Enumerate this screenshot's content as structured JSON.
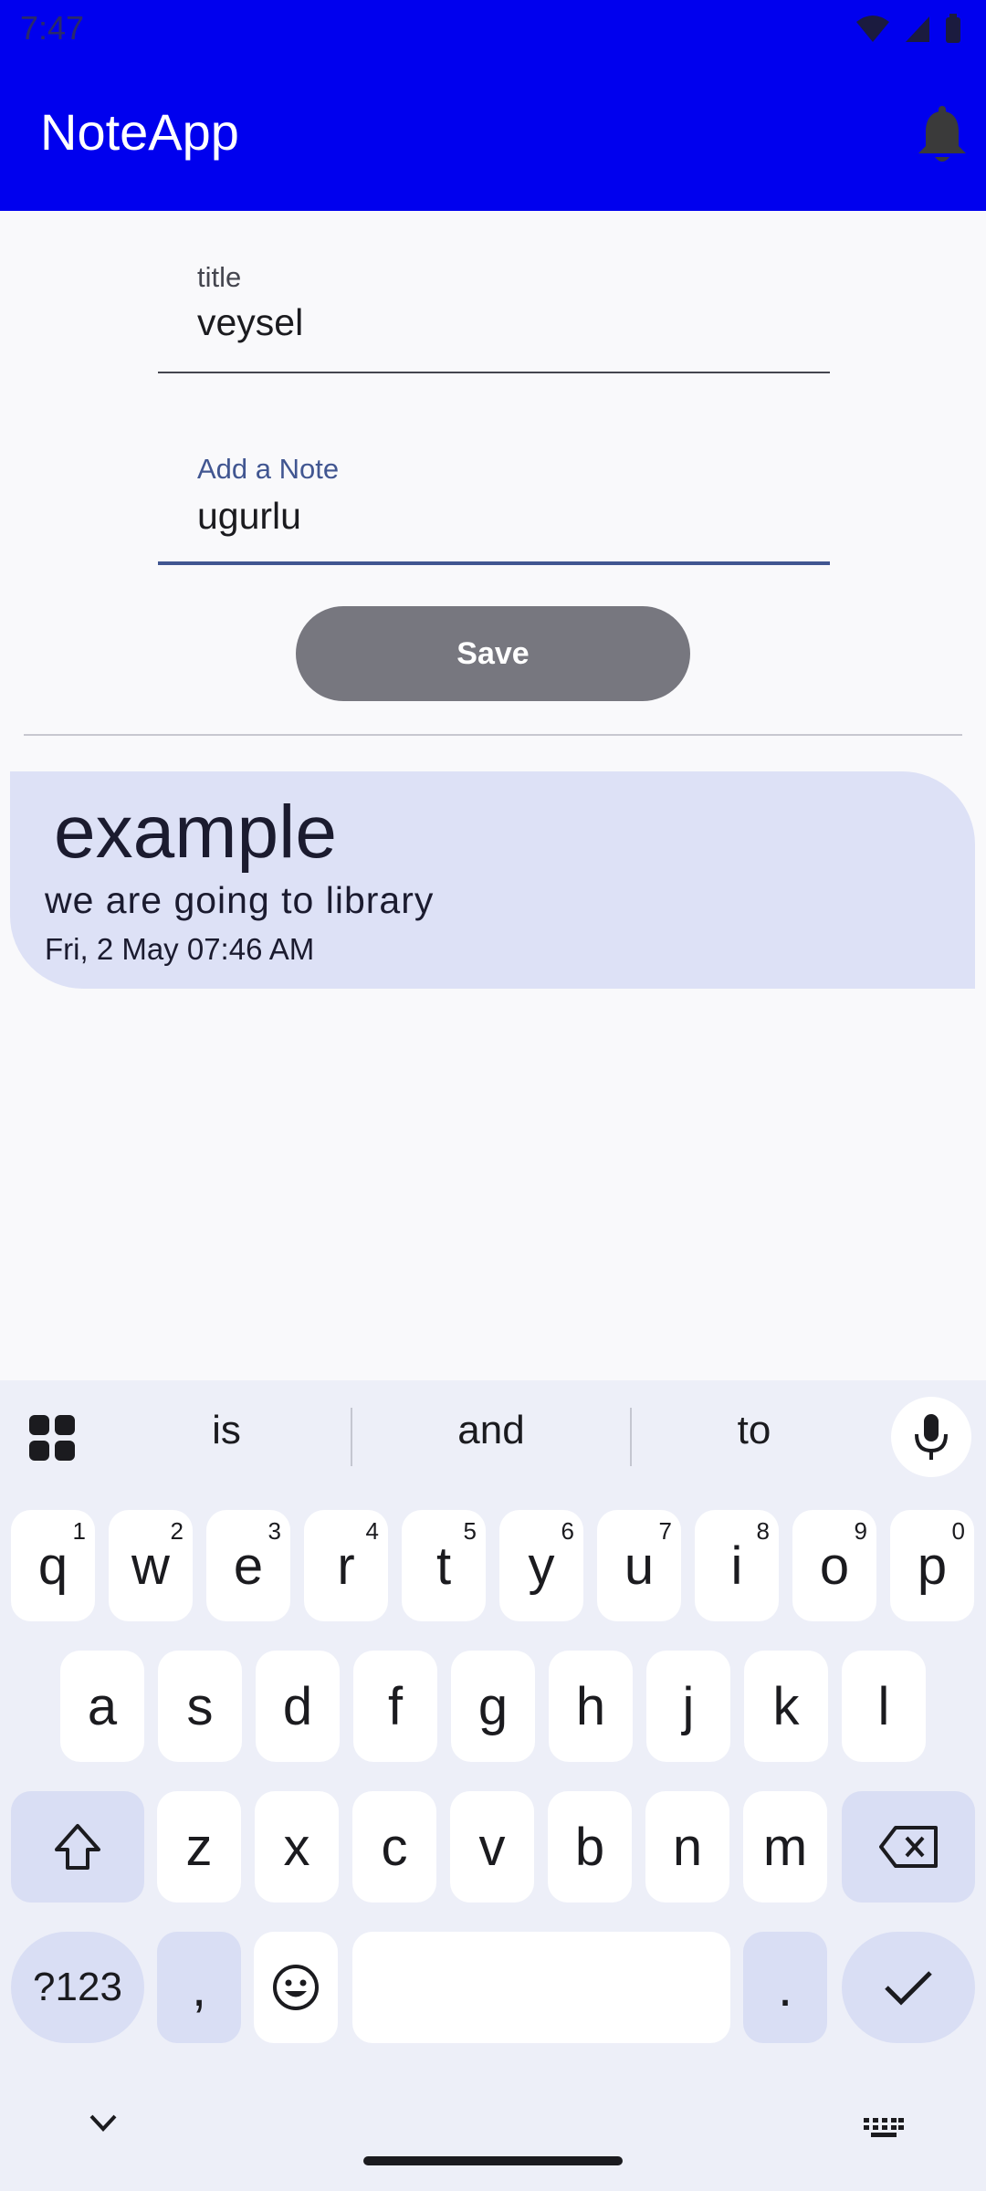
{
  "status": {
    "time": "7:47"
  },
  "app": {
    "title": "NoteApp"
  },
  "form": {
    "title_label": "title",
    "title_value": "veysel",
    "note_label": "Add a Note",
    "note_value": "ugurlu",
    "save_label": "Save"
  },
  "notes": [
    {
      "title": "example",
      "body": "we are going to library",
      "date": "Fri, 2 May 07:46 AM"
    }
  ],
  "keyboard": {
    "suggestions": [
      "is",
      "and",
      "to"
    ],
    "row1": [
      {
        "k": "q",
        "h": "1"
      },
      {
        "k": "w",
        "h": "2"
      },
      {
        "k": "e",
        "h": "3"
      },
      {
        "k": "r",
        "h": "4"
      },
      {
        "k": "t",
        "h": "5"
      },
      {
        "k": "y",
        "h": "6"
      },
      {
        "k": "u",
        "h": "7"
      },
      {
        "k": "i",
        "h": "8"
      },
      {
        "k": "o",
        "h": "9"
      },
      {
        "k": "p",
        "h": "0"
      }
    ],
    "row2": [
      "a",
      "s",
      "d",
      "f",
      "g",
      "h",
      "j",
      "k",
      "l"
    ],
    "row3": [
      "z",
      "x",
      "c",
      "v",
      "b",
      "n",
      "m"
    ],
    "symbols_label": "?123",
    "comma": ",",
    "period": "."
  },
  "colors": {
    "app_bar": "#0000ee",
    "card": "#dde1f6",
    "accent": "#415691"
  }
}
